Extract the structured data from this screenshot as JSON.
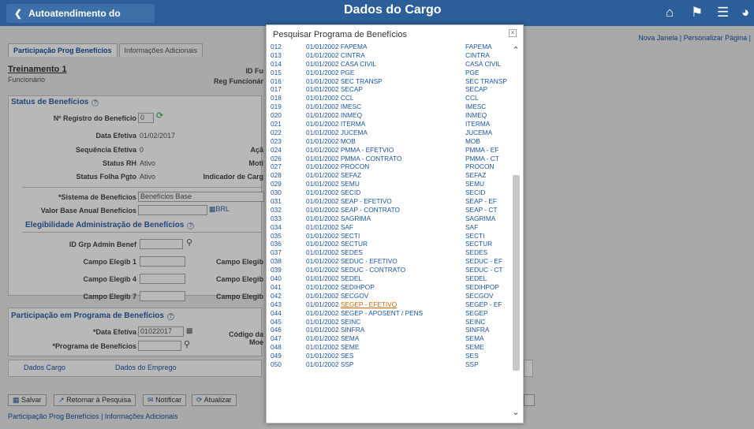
{
  "header": {
    "back_label": "Autoatendimento do Gerente",
    "title": "Dados do Cargo",
    "icons": [
      "home-icon",
      "flag-icon",
      "menu-icon",
      "compass-icon"
    ]
  },
  "page": {
    "toplinks": "Nova Janela | Personalizar Página | ",
    "tabs": [
      "Participação Prog Benefícios",
      "Informações Adicionais"
    ],
    "person": {
      "name": "Treinamento 1",
      "role": "Funcionário",
      "id_label": "ID Fu",
      "reg_label": "Reg Funcionár"
    },
    "status": {
      "title": "Status de Benefícios",
      "reg_label": "Nº Registro do Benefício",
      "reg_value": "0",
      "data_efetiva_label": "Data Efetiva",
      "data_efetiva_value": "01/02/2017",
      "seq_label": "Sequência Efetiva",
      "seq_value": "0",
      "status_rh_label": "Status RH",
      "status_rh_value": "Ativo",
      "folha_label": "Status Folha Pgto",
      "folha_value": "Ativo",
      "acao_label": "Açã",
      "motivo_label": "Moti",
      "indicador_label": "Indicador de Carg",
      "sistema_label": "*Sistema de Benefícios",
      "sistema_value": "Benefícios Base",
      "valor_label": "Valor Base Anual Benefícios",
      "valor_unit": "BRL"
    },
    "eleg": {
      "title": "Elegibilidade Administração de Benefícios",
      "grp_label": "ID Grp Admin Benef",
      "c1": "Campo Elegib 1",
      "c4": "Campo Elegib 4",
      "c7": "Campo Elegib 7",
      "c_right": "Campo Elegib"
    },
    "part": {
      "title": "Participação em Programa de Benefícios",
      "data_label": "*Data Efetiva",
      "data_value": "01022017",
      "prog_label": "*Programa de Benefícios",
      "codigo_label": "Código da Moe"
    },
    "links": {
      "dados_cargo": "Dados Cargo",
      "dados_emprego": "Dados do Emprego"
    },
    "buttons": {
      "salvar": "Salvar",
      "retornar": "Retornar à Pesquisa",
      "notificar": "Notificar",
      "atualizar": "Atualizar"
    },
    "footer": "Participação Prog Benefícios | Informações Adicionais"
  },
  "modal": {
    "title": "Pesquisar Programa de Benefícios",
    "close": "×",
    "highlight_row": "043",
    "rows": [
      [
        "012",
        "01/01/2002",
        "FAPEMA",
        "FAPEMA"
      ],
      [
        "013",
        "01/01/2002",
        "CINTRA",
        "CINTRA"
      ],
      [
        "014",
        "01/01/2002",
        "CASA CIVIL",
        "CASA CIVIL"
      ],
      [
        "015",
        "01/01/2002",
        "PGE",
        "PGE"
      ],
      [
        "016",
        "01/01/2002",
        "SEC TRANSP",
        "SEC TRANSP"
      ],
      [
        "017",
        "01/01/2002",
        "SECAP",
        "SECAP"
      ],
      [
        "018",
        "01/01/2002",
        "CCL",
        "CCL"
      ],
      [
        "019",
        "01/01/2002",
        "IMESC",
        "IMESC"
      ],
      [
        "020",
        "01/01/2002",
        "INMEQ",
        "INMEQ"
      ],
      [
        "021",
        "01/01/2002",
        "ITERMA",
        "ITERMA"
      ],
      [
        "022",
        "01/01/2002",
        "JUCEMA",
        "JUCEMA"
      ],
      [
        "023",
        "01/01/2002",
        "MOB",
        "MOB"
      ],
      [
        "024",
        "01/01/2002",
        "PMMA - EFETVIO",
        "PMMA - EF"
      ],
      [
        "026",
        "01/01/2002",
        "PMMA - CONTRATO",
        "PMMA - CT"
      ],
      [
        "027",
        "01/01/2002",
        "PROCON",
        "PROCON"
      ],
      [
        "028",
        "01/01/2002",
        "SEFAZ",
        "SEFAZ"
      ],
      [
        "029",
        "01/01/2002",
        "SEMU",
        "SEMU"
      ],
      [
        "030",
        "01/01/2002",
        "SECID",
        "SECID"
      ],
      [
        "031",
        "01/01/2002",
        "SEAP - EFETIVO",
        "SEAP - EF"
      ],
      [
        "032",
        "01/01/2002",
        "SEAP - CONTRATO",
        "SEAP - CT"
      ],
      [
        "033",
        "01/01/2002",
        "SAGRIMA",
        "SAGRIMA"
      ],
      [
        "034",
        "01/01/2002",
        "SAF",
        "SAF"
      ],
      [
        "035",
        "01/01/2002",
        "SECTI",
        "SECTI"
      ],
      [
        "036",
        "01/01/2002",
        "SECTUR",
        "SECTUR"
      ],
      [
        "037",
        "01/01/2002",
        "SEDES",
        "SEDES"
      ],
      [
        "038",
        "01/01/2002",
        "SEDUC - EFETIVO",
        "SEDUC - EF"
      ],
      [
        "039",
        "01/01/2002",
        "SEDUC - CONTRATO",
        "SEDUC - CT"
      ],
      [
        "040",
        "01/01/2002",
        "SEDEL",
        "SEDEL"
      ],
      [
        "041",
        "01/01/2002",
        "SEDIHPOP",
        "SEDIHPOP"
      ],
      [
        "042",
        "01/01/2002",
        "SECGOV",
        "SECGOV"
      ],
      [
        "043",
        "01/01/2002",
        "SEGEP - EFETIVO",
        "SEGEP - EF"
      ],
      [
        "044",
        "01/01/2002",
        "SEGEP - APOSENT / PENS",
        "SEGEP"
      ],
      [
        "045",
        "01/01/2002",
        "SEINC",
        "SEINC"
      ],
      [
        "046",
        "01/01/2002",
        "SINFRA",
        "SINFRA"
      ],
      [
        "047",
        "01/01/2002",
        "SEMA",
        "SEMA"
      ],
      [
        "048",
        "01/01/2002",
        "SEME",
        "SEME"
      ],
      [
        "049",
        "01/01/2002",
        "SES",
        "SES"
      ],
      [
        "050",
        "01/01/2002",
        "SSP",
        "SSP"
      ]
    ]
  }
}
